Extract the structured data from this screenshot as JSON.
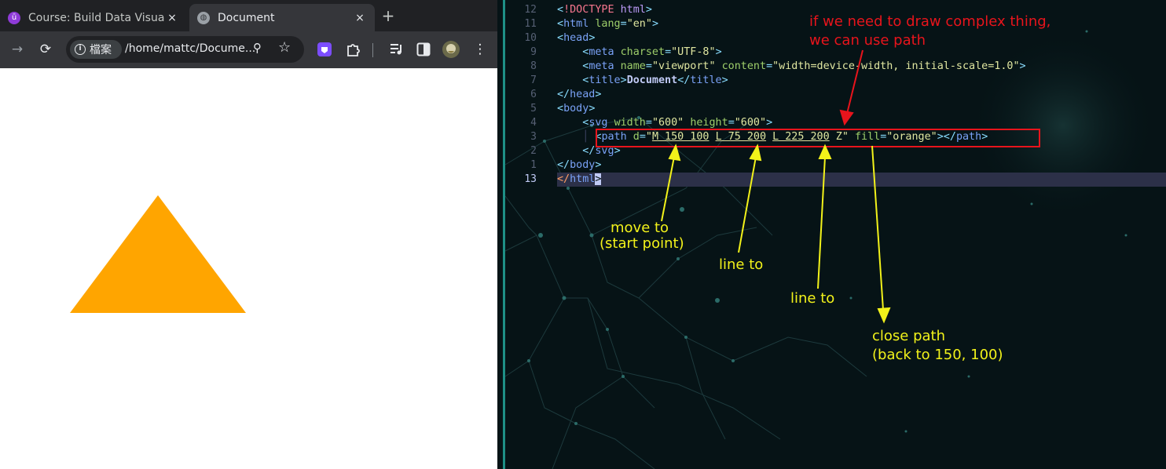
{
  "browser": {
    "tabs": [
      {
        "label": "Course: Build Data Visua",
        "icon": "udemy-favicon-icon",
        "close": "×"
      },
      {
        "label": "Document",
        "icon": "globe-favicon-icon",
        "close": "×"
      }
    ],
    "new_tab": "+",
    "toolbar": {
      "back": "→",
      "reload": "⟳",
      "site_chip_label": "檔案",
      "url": "/home/mattc/Docume...",
      "zoom_icon": "zoom-icon",
      "bookmark_icon": "star-icon"
    },
    "page_content": {
      "shape": "triangle",
      "fill": "#FFA500"
    }
  },
  "editor": {
    "lines": [
      {
        "num": "12"
      },
      {
        "num": "11"
      },
      {
        "num": "10"
      },
      {
        "num": "9"
      },
      {
        "num": "8"
      },
      {
        "num": "7"
      },
      {
        "num": "6"
      },
      {
        "num": "5"
      },
      {
        "num": "4"
      },
      {
        "num": "3"
      },
      {
        "num": "2"
      },
      {
        "num": "1"
      },
      {
        "num": "13"
      }
    ],
    "code": {
      "l1_doctype": "!DOCTYPE",
      "l1_html": "html",
      "l2_tag": "html",
      "l2_attr": "lang",
      "l2_val": "\"en\"",
      "l3_tag": "head",
      "l4_tag": "meta",
      "l4_attr": "charset",
      "l4_val": "\"UTF-8\"",
      "l5_tag": "meta",
      "l5_attr1": "name",
      "l5_val1": "\"viewport\"",
      "l5_attr2": "content",
      "l5_val2": "\"width=device-width, initial-scale=1.0\"",
      "l6_tag": "title",
      "l6_text": "Document",
      "l6_close": "title",
      "l7_tag": "head",
      "l8_tag": "body",
      "l9_tag": "svg",
      "l9_attr1": "width",
      "l9_val1": "\"600\"",
      "l9_attr2": "height",
      "l9_val2": "\"600\"",
      "l10_tag": "path",
      "l10_attr1": "d",
      "l10_q1": "\"",
      "l10_seg1": "M 150 100",
      "l10_seg2": "L 75 200",
      "l10_seg3": "L 225 200",
      "l10_seg4": "Z",
      "l10_q2": "\"",
      "l10_attr2": "fill",
      "l10_val2": "\"orange\"",
      "l10_close": "path",
      "l11_tag": "svg",
      "l12_tag": "body",
      "l13_tag": "html"
    },
    "annotations": {
      "red_note_line1": "if we need to draw complex thing,",
      "red_note_line2": "we can use path",
      "move_to_line1": "move to",
      "move_to_line2": "(start point)",
      "line_to_1": "line to",
      "line_to_2": "line to",
      "close_path_line1": "close path",
      "close_path_line2": "(back to 150, 100)"
    },
    "colors": {
      "annotation_yellow": "#f2f21a",
      "annotation_red": "#e8141c",
      "highlight_box": "#e8141c"
    }
  }
}
